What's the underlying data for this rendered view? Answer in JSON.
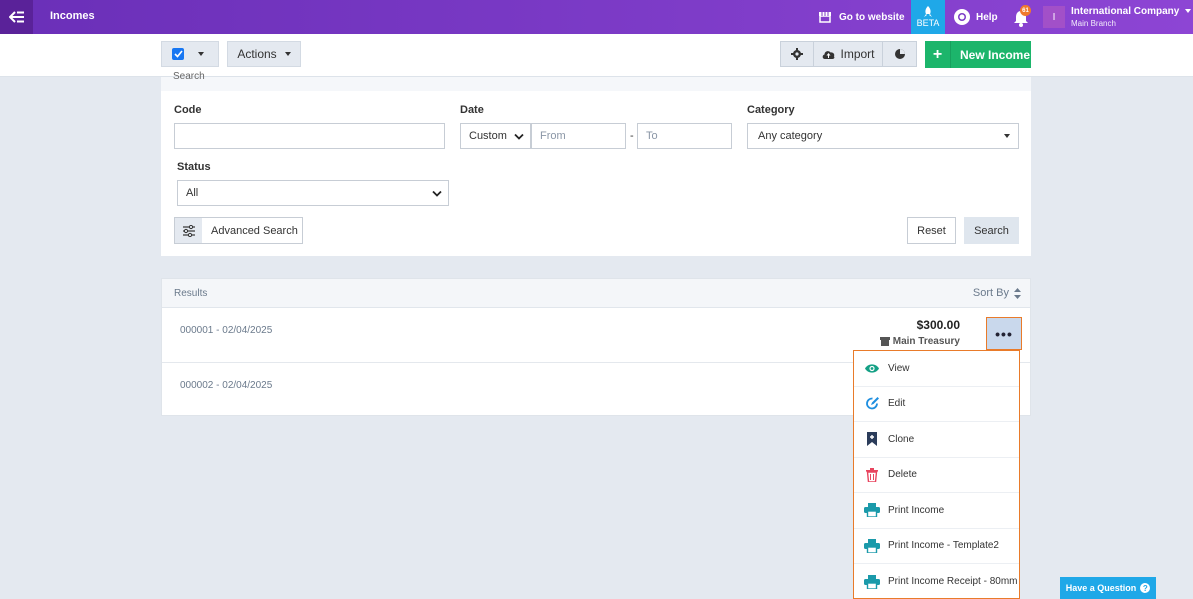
{
  "topbar": {
    "page_title": "Incomes",
    "go_to_website": "Go to website",
    "beta": "BETA",
    "help": "Help",
    "notification_count": "61",
    "avatar_letter": "I",
    "company_name": "International Company",
    "branch": "Main Branch",
    "colors": {
      "gradient_start": "#6a2fb8",
      "gradient_end": "#8d45d4",
      "beta": "#1fa8e8"
    }
  },
  "toolbar": {
    "actions_label": "Actions",
    "import_label": "Import",
    "new_income_label": "New Income",
    "new_income_color": "#1cb56b"
  },
  "search": {
    "title": "Search",
    "code_label": "Code",
    "code_value": "",
    "date_label": "Date",
    "date_mode": "Custom",
    "from_placeholder": "From",
    "to_placeholder": "To",
    "date_separator": "-",
    "category_label": "Category",
    "category_value": "Any category",
    "status_label": "Status",
    "status_value": "All",
    "advanced_label": "Advanced Search",
    "reset_label": "Reset",
    "search_label": "Search"
  },
  "results": {
    "title": "Results",
    "sort_by": "Sort By",
    "rows": [
      {
        "code": "000001 - 02/04/2025",
        "amount": "$300.00",
        "treasury": "Main Treasury"
      },
      {
        "code": "000002 - 02/04/2025"
      }
    ],
    "more_label": "•••"
  },
  "menu": {
    "items": [
      {
        "label": "View",
        "icon": "eye-icon"
      },
      {
        "label": "Edit",
        "icon": "edit-icon"
      },
      {
        "label": "Clone",
        "icon": "clone-icon"
      },
      {
        "label": "Delete",
        "icon": "trash-icon"
      },
      {
        "label": "Print Income",
        "icon": "printer-icon"
      },
      {
        "label": "Print Income - Template2",
        "icon": "printer-icon"
      },
      {
        "label": "Print Income Receipt - 80mm",
        "icon": "printer-icon"
      }
    ],
    "border_color": "#e97b2a"
  },
  "help_widget": {
    "label": "Have a Question"
  }
}
